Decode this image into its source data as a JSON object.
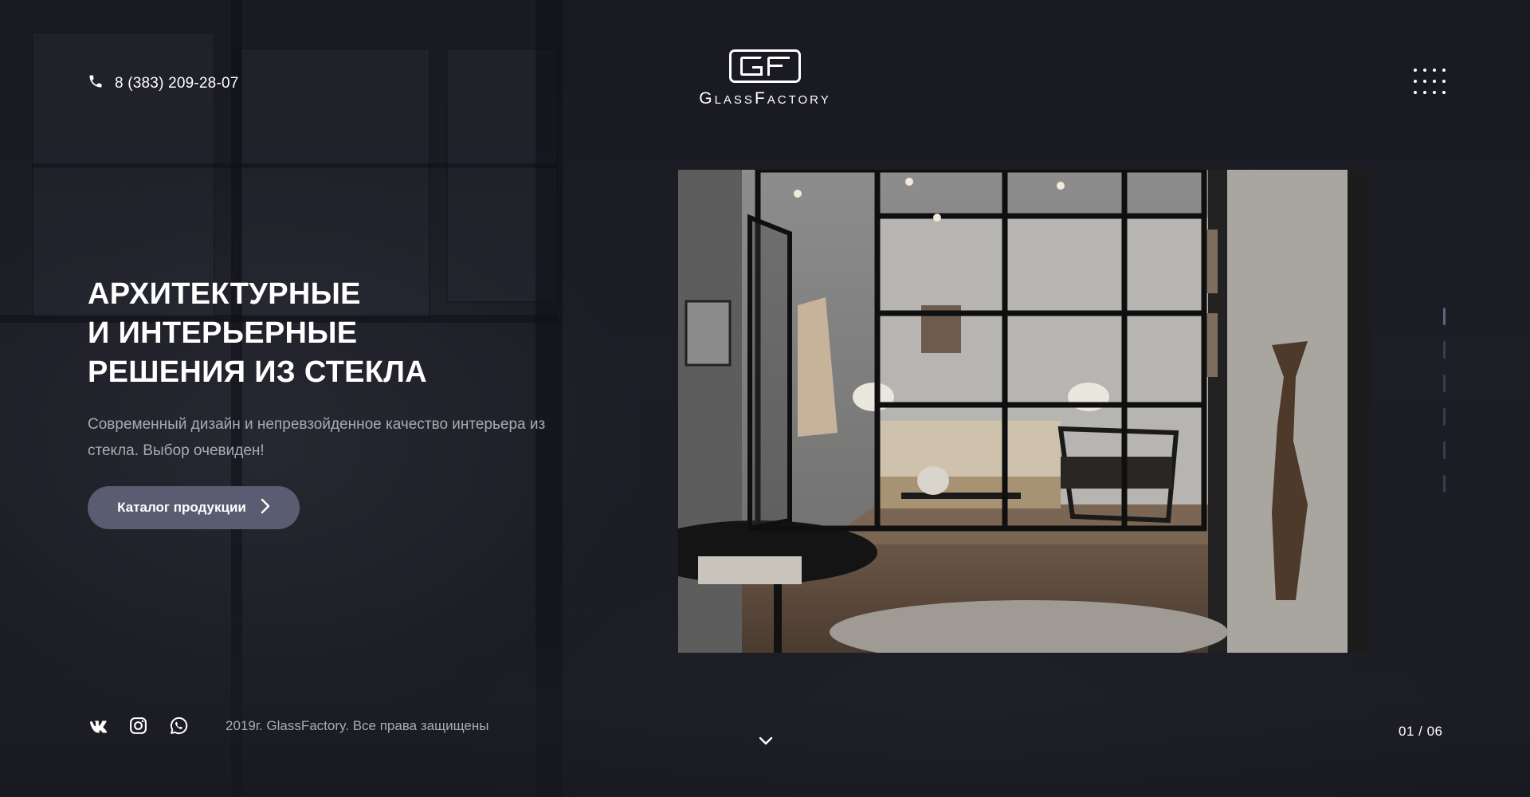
{
  "header": {
    "phone": "8 (383) 209-28-07",
    "logo_mark": "GF",
    "logo_text": "GlassFactory",
    "menu_icon": "grid-menu-icon"
  },
  "hero": {
    "title_lines": [
      "АРХИТЕКТУРНЫЕ",
      "И ИНТЕРЬЕРНЫЕ",
      "РЕШЕНИЯ ИЗ СТЕКЛА"
    ],
    "subtitle": "Современный дизайн и непревзойденное качество интерьера из стекла. Выбор очевиден!",
    "cta_label": "Каталог продукции"
  },
  "slider": {
    "current": "01",
    "total": "06",
    "counter_text": "01 / 06",
    "dots": 6,
    "active_index": 0
  },
  "footer": {
    "socials": [
      "vk-icon",
      "instagram-icon",
      "whatsapp-icon"
    ],
    "copyright": "2019г. GlassFactory. Все права защищены"
  },
  "colors": {
    "background": "#1b1c23",
    "button": "#5a5d72",
    "muted_text": "#a9aab3",
    "pager_inactive": "#3a3d52",
    "pager_active": "#5d6486"
  }
}
